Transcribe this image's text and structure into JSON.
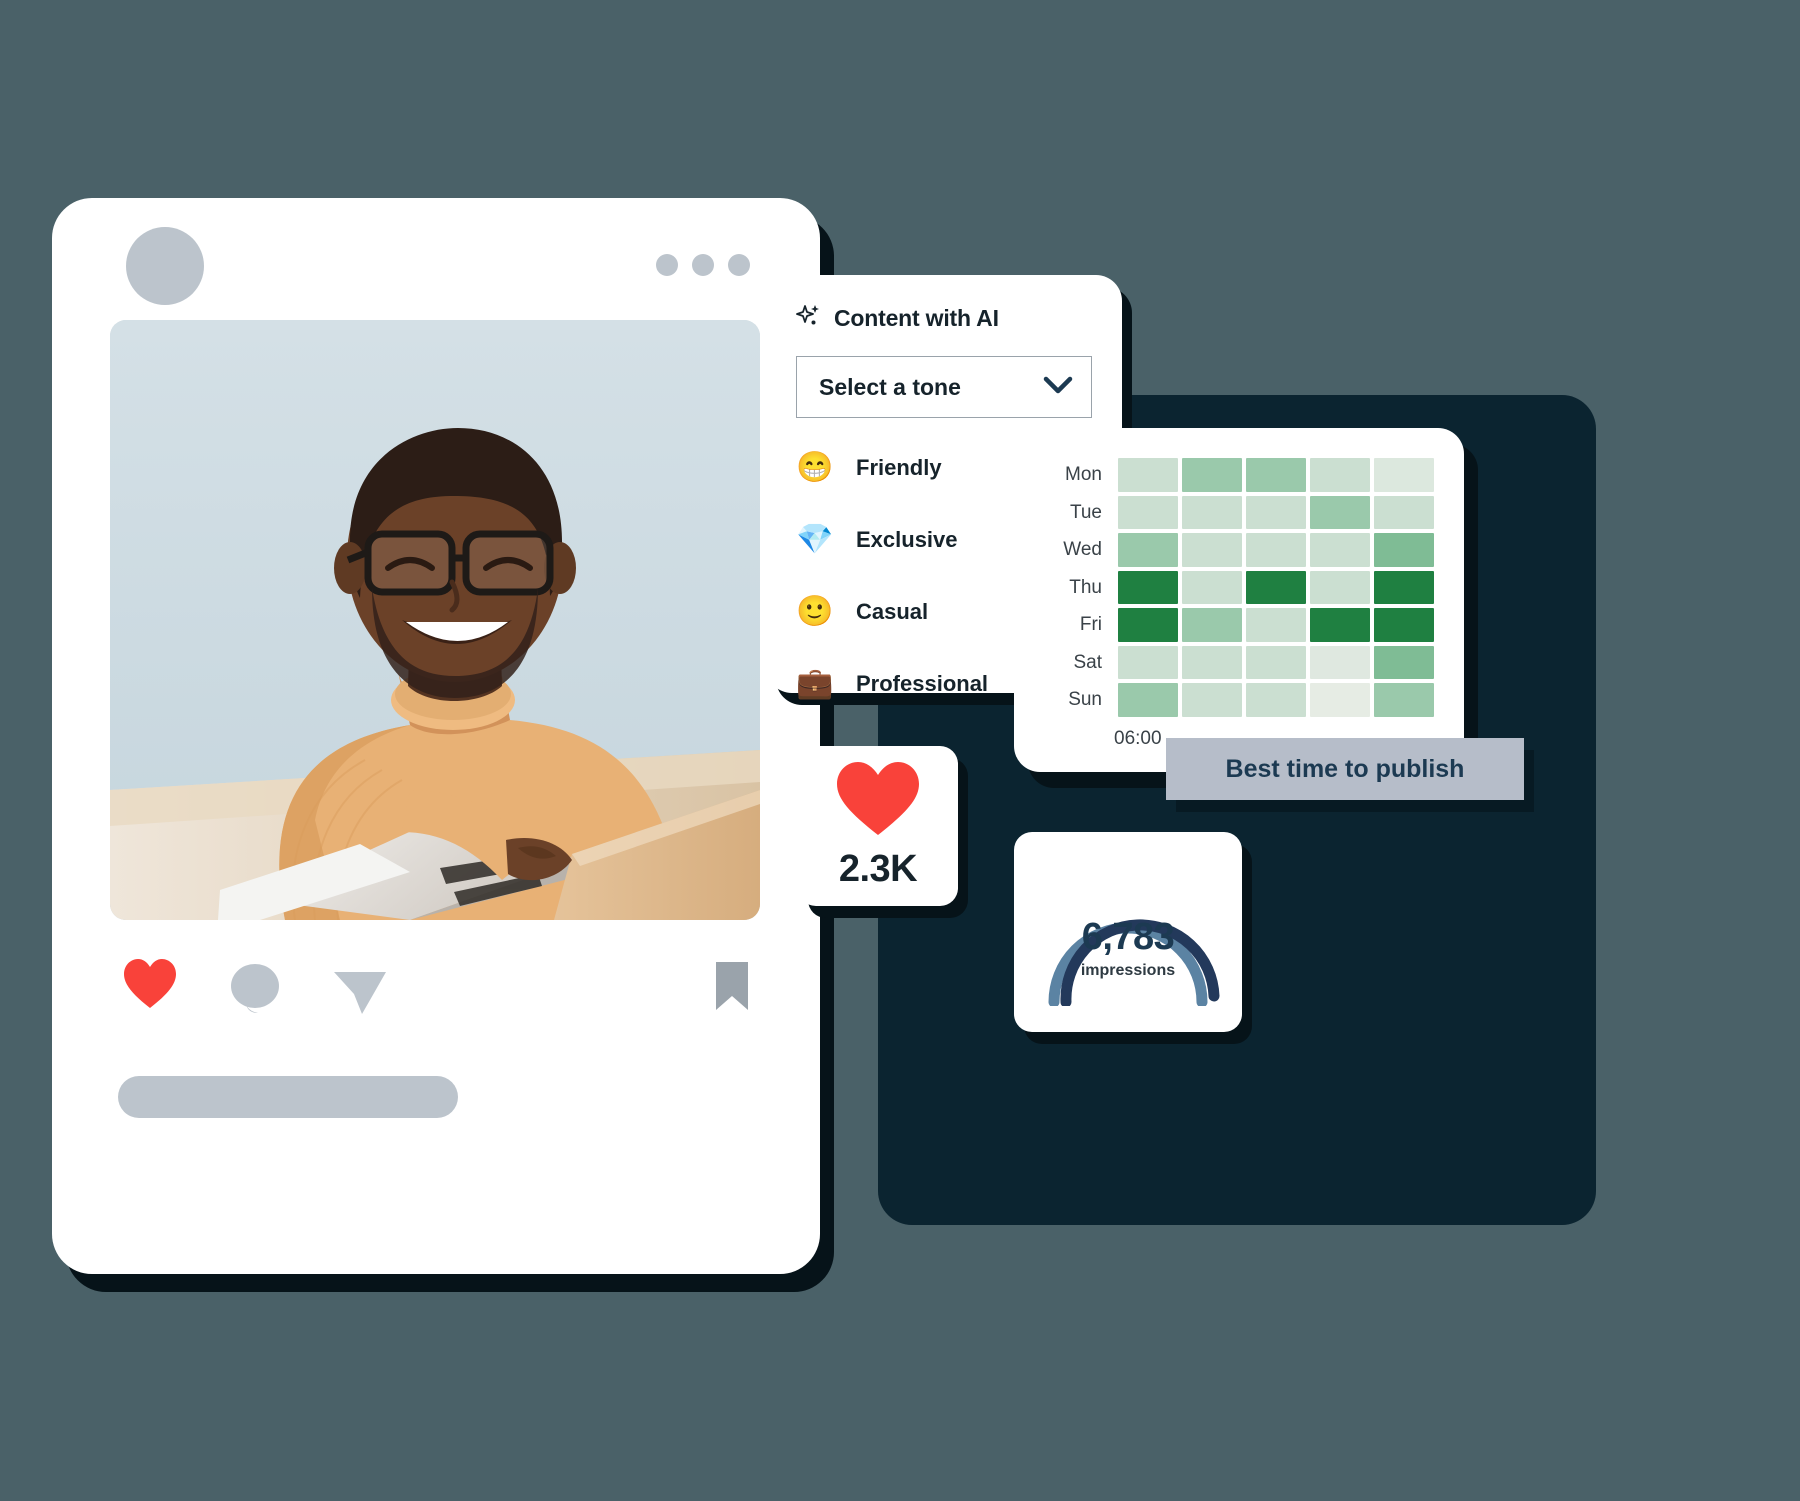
{
  "post": {
    "avatar_name": "avatar",
    "menu_label": "more-options",
    "actions": [
      {
        "name": "like",
        "icon": "heart-icon"
      },
      {
        "name": "comment",
        "icon": "comment-icon"
      },
      {
        "name": "share",
        "icon": "share-icon"
      },
      {
        "name": "save",
        "icon": "bookmark-icon"
      }
    ]
  },
  "ai_panel": {
    "title": "Content with AI",
    "sparkle_icon": "sparkle-icon",
    "select_label": "Select a tone",
    "chevron_icon": "chevron-down-icon",
    "tones": [
      {
        "emoji": "😁",
        "label": "Friendly",
        "icon_name": "grinning-face-icon"
      },
      {
        "emoji": "💎",
        "label": "Exclusive",
        "icon_name": "gem-icon"
      },
      {
        "emoji": "🙂",
        "label": "Casual",
        "icon_name": "slight-smile-icon"
      },
      {
        "emoji": "💼",
        "label": "Professional",
        "icon_name": "briefcase-icon"
      }
    ]
  },
  "heatmap_card": {
    "time_label": "06:00",
    "tooltip": "Best time to publish"
  },
  "likes_card": {
    "icon": "heart-icon",
    "value": "2.3K"
  },
  "impressions_card": {
    "value": "6,783",
    "label": "impressions"
  },
  "colors": {
    "background": "#4a6168",
    "dark_panel": "#0b2430",
    "card": "#ffffff",
    "heart_red": "#f9423a",
    "placeholder_grey": "#bcc4cc",
    "tooltip_bg": "#b6bdc9",
    "tooltip_text": "#1c3a52",
    "gauge_dark": "#23395b",
    "gauge_light": "#5b83a3",
    "green_dark": "#1f8041",
    "green_mid": "#9ac9ab",
    "green_light": "#cbdfd1",
    "green_faint": "#e0e9e1"
  },
  "chart_data": {
    "type": "heatmap",
    "title": "Best time to publish",
    "xlabel": "",
    "ylabel": "",
    "rows": [
      "Mon",
      "Tue",
      "Wed",
      "Thu",
      "Fri",
      "Sat",
      "Sun"
    ],
    "columns": [
      "06:00",
      "",
      "",
      "",
      ""
    ],
    "colorscale": [
      "#e6ece4",
      "#cbdfd1",
      "#9ac9ab",
      "#1f8041"
    ],
    "values": [
      [
        1,
        2,
        2,
        1,
        0
      ],
      [
        1,
        1,
        1,
        2,
        1
      ],
      [
        2,
        1,
        1,
        1,
        2
      ],
      [
        3,
        1,
        3,
        1,
        3
      ],
      [
        3,
        2,
        1,
        3,
        3
      ],
      [
        1,
        1,
        1,
        0,
        2
      ],
      [
        2,
        1,
        1,
        0,
        1
      ]
    ],
    "cell_colors": [
      [
        "#cbdfd1",
        "#9ac9ab",
        "#9ac9ab",
        "#cbdfd1",
        "#dce8de"
      ],
      [
        "#cbdfd1",
        "#cbdfd1",
        "#cbdfd1",
        "#9ac9ab",
        "#cbdfd1"
      ],
      [
        "#9ac9ab",
        "#cbdfd1",
        "#cbdfd1",
        "#cbdfd1",
        "#7fbc95"
      ],
      [
        "#1f8041",
        "#cbdfd1",
        "#1f8041",
        "#cbdfd1",
        "#1f8041"
      ],
      [
        "#1f8041",
        "#9ac9ab",
        "#cbdfd1",
        "#1f8041",
        "#1f8041"
      ],
      [
        "#cbdfd1",
        "#cbdfd1",
        "#cbdfd1",
        "#dfe8e0",
        "#7fbc95"
      ],
      [
        "#9ac9ab",
        "#cbdfd1",
        "#cbdfd1",
        "#e6ece4",
        "#9ac9ab"
      ]
    ]
  }
}
